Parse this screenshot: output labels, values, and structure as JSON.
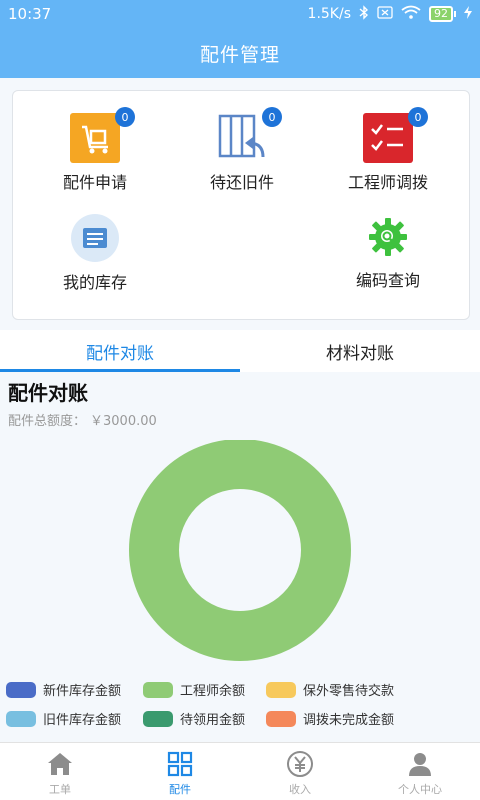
{
  "status_bar": {
    "time": "10:37",
    "speed": "1.5K/s",
    "battery": "92"
  },
  "header": {
    "title": "配件管理"
  },
  "grid": {
    "items": [
      {
        "label": "配件申请",
        "badge": "0",
        "icon": "cart-icon"
      },
      {
        "label": "待还旧件",
        "badge": "0",
        "icon": "return-parts-icon"
      },
      {
        "label": "工程师调拨",
        "badge": "0",
        "icon": "checklist-icon"
      },
      {
        "label": "我的库存",
        "icon": "inventory-icon"
      },
      {
        "label": "编码查询",
        "icon": "code-query-gear-icon"
      }
    ]
  },
  "tabs": [
    {
      "label": "配件对账",
      "active": true
    },
    {
      "label": "材料对账",
      "active": false
    }
  ],
  "section": {
    "title": "配件对账",
    "total_label": "配件总额度：",
    "total_value": "￥3000.00"
  },
  "chart_data": {
    "type": "pie",
    "donut": true,
    "labels": [
      "新件库存金额",
      "工程师余额",
      "保外零售待交款",
      "旧件库存金额",
      "待领用金额",
      "调拨未完成金额"
    ],
    "colors": [
      "#4a6cc7",
      "#8fcb75",
      "#f7c95c",
      "#78bfe0",
      "#3a9a6e",
      "#f4885a"
    ],
    "values": [
      0,
      3000,
      0,
      0,
      0,
      0
    ],
    "legend_position": "bottom"
  },
  "legend": [
    {
      "label": "新件库存金额",
      "color": "#4a6cc7"
    },
    {
      "label": "工程师余额",
      "color": "#8fcb75"
    },
    {
      "label": "保外零售待交款",
      "color": "#f7c95c"
    },
    {
      "label": "旧件库存金额",
      "color": "#78bfe0"
    },
    {
      "label": "待领用金额",
      "color": "#3a9a6e"
    },
    {
      "label": "调拨未完成金额",
      "color": "#f4885a"
    }
  ],
  "bottom_nav": [
    {
      "label": "工单",
      "icon": "home-icon",
      "active": false
    },
    {
      "label": "配件",
      "icon": "grid-icon",
      "active": true
    },
    {
      "label": "收入",
      "icon": "yuan-icon",
      "active": false
    },
    {
      "label": "个人中心",
      "icon": "user-icon",
      "active": false
    }
  ],
  "colors": {
    "header": "#64b5f6",
    "accent": "#1e88e5"
  }
}
